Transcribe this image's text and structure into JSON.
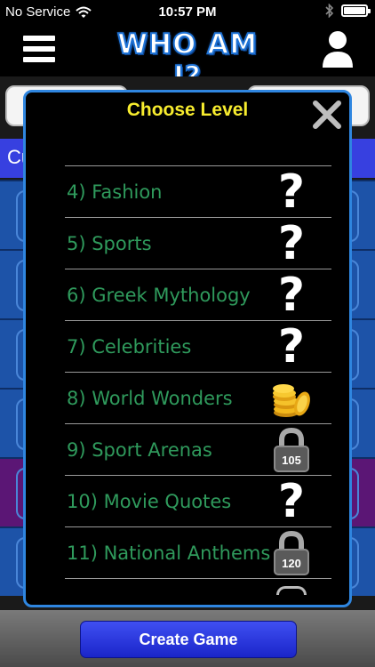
{
  "status_bar": {
    "carrier": "No Service",
    "time": "10:57 PM",
    "icons": [
      "wifi-icon",
      "bluetooth-icon",
      "battery-icon"
    ]
  },
  "header": {
    "title": "WHO AM I?",
    "menu_icon": "hamburger-menu-icon",
    "profile_icon": "user-profile-icon"
  },
  "background": {
    "strip_text": "Cu"
  },
  "modal": {
    "title": "Choose Level",
    "close_icon": "close-x-icon",
    "levels": [
      {
        "label": "4) Fashion",
        "status": "unlocked",
        "icon": "question-mark-icon"
      },
      {
        "label": "5) Sports",
        "status": "unlocked",
        "icon": "question-mark-icon"
      },
      {
        "label": "6) Greek Mythology",
        "status": "unlocked",
        "icon": "question-mark-icon"
      },
      {
        "label": "7) Celebrities",
        "status": "unlocked",
        "icon": "question-mark-icon"
      },
      {
        "label": "8) World Wonders",
        "status": "completed",
        "icon": "gold-coins-icon"
      },
      {
        "label": "9) Sport Arenas",
        "status": "locked",
        "icon": "padlock-icon",
        "unlock_cost": "105"
      },
      {
        "label": "10) Movie Quotes",
        "status": "unlocked",
        "icon": "question-mark-icon"
      },
      {
        "label": "11) National Anthems",
        "status": "locked",
        "icon": "padlock-icon",
        "unlock_cost": "120"
      }
    ]
  },
  "footer": {
    "create_game_label": "Create Game"
  },
  "colors": {
    "title_yellow": "#f7ec2e",
    "level_green": "#2f9a5c",
    "modal_border": "#2f86e0",
    "button_blue": "#2a36e0"
  }
}
